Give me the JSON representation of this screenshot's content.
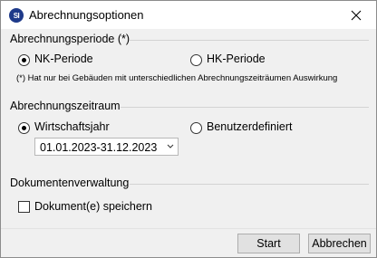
{
  "window": {
    "title": "Abrechnungsoptionen",
    "app_icon_text": "SI",
    "close_glyph": "close-icon"
  },
  "period": {
    "label": "Abrechnungsperiode (*)",
    "options": [
      {
        "label": "NK-Periode",
        "selected": true
      },
      {
        "label": "HK-Periode",
        "selected": false
      }
    ],
    "note": "(*) Hat nur bei Gebäuden mit unterschiedlichen Abrechnungszeiträumen Auswirkung"
  },
  "timeframe": {
    "label": "Abrechnungszeitraum",
    "options": [
      {
        "label": "Wirtschaftsjahr",
        "selected": true
      },
      {
        "label": "Benutzerdefiniert",
        "selected": false
      }
    ],
    "selected_range": "01.01.2023-31.12.2023"
  },
  "documents": {
    "label": "Dokumentenverwaltung",
    "save_label": "Dokument(e) speichern",
    "save_checked": false
  },
  "buttons": {
    "start": "Start",
    "cancel": "Abbrechen"
  },
  "colors": {
    "app_icon": "#1e3a8a",
    "dialog_bg": "#f0f0f0",
    "button_bg": "#e1e1e1"
  }
}
